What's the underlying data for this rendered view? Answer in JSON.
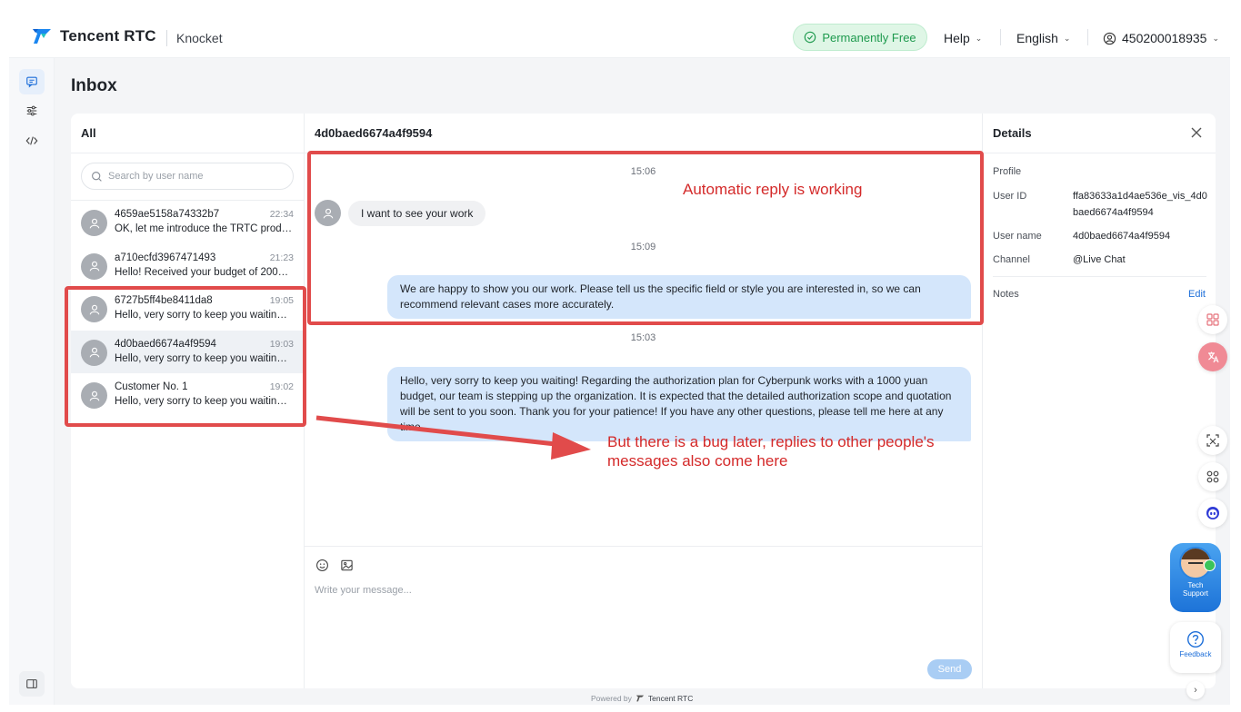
{
  "header": {
    "brand": "Tencent RTC",
    "app_name": "Knocket",
    "free_label": "Permanently Free",
    "help_label": "Help",
    "language_label": "English",
    "account_id": "450200018935"
  },
  "page": {
    "title": "Inbox"
  },
  "conversations": {
    "tab_label": "All",
    "search_placeholder": "Search by user name",
    "items": [
      {
        "name": "4659ae5158a74332b7",
        "time": "22:34",
        "preview": "OK, let me introduce the TRTC product ..."
      },
      {
        "name": "a710ecfd3967471493",
        "time": "21:23",
        "preview": "Hello! Received your budget of 2000 yu..."
      },
      {
        "name": "6727b5ff4be8411da8",
        "time": "19:05",
        "preview": "Hello, very sorry to keep you waiting! Ab..."
      },
      {
        "name": "4d0baed6674a4f9594",
        "time": "19:03",
        "preview": "Hello, very sorry to keep you waiting! Ab..."
      },
      {
        "name": "Customer No. 1",
        "time": "19:02",
        "preview": "Hello, very sorry to keep you waiting! Ab..."
      }
    ]
  },
  "chat": {
    "title": "4d0baed6674a4f9594",
    "messages": [
      {
        "time": "15:06",
        "direction": "in",
        "text": "I want to see your work"
      },
      {
        "time": "15:09",
        "direction": "out",
        "text": "We are happy to show you our work. Please tell us the specific field or style you are interested in, so we can recommend relevant cases more accurately."
      },
      {
        "time": "15:03",
        "direction": "out",
        "text": "Hello, very sorry to keep you waiting! Regarding the authorization plan for Cyberpunk works with a 1000 yuan budget, our team is stepping up the organization. It is expected that the detailed authorization scope and quotation will be sent to you soon. Thank you for your patience! If you have any other questions, please tell me here at any time."
      }
    ],
    "composer_placeholder": "Write your message...",
    "send_label": "Send"
  },
  "details": {
    "title": "Details",
    "profile_label": "Profile",
    "user_id_label": "User ID",
    "user_id_value": "ffa83633a1d4ae536e_vis_4d0baed6674a4f9594",
    "user_name_label": "User name",
    "user_name_value": "4d0baed6674a4f9594",
    "channel_label": "Channel",
    "channel_value": "@Live Chat",
    "notes_label": "Notes",
    "edit_label": "Edit"
  },
  "annotations": {
    "auto_reply": "Automatic reply is working",
    "bug_line1": "But there is a bug later, replies to other people's",
    "bug_line2": "messages also come here"
  },
  "widgets": {
    "tech_support_line1": "Tech",
    "tech_support_line2": "Support",
    "feedback_label": "Feedback"
  },
  "footer": {
    "powered_by": "Powered by",
    "powered_brand": "Tencent RTC"
  },
  "colors": {
    "accent": "#1e6fd9",
    "annotation": "#e14b4b",
    "free_pill": "#1e9a4e",
    "bubble_out": "#d4e6fb"
  }
}
